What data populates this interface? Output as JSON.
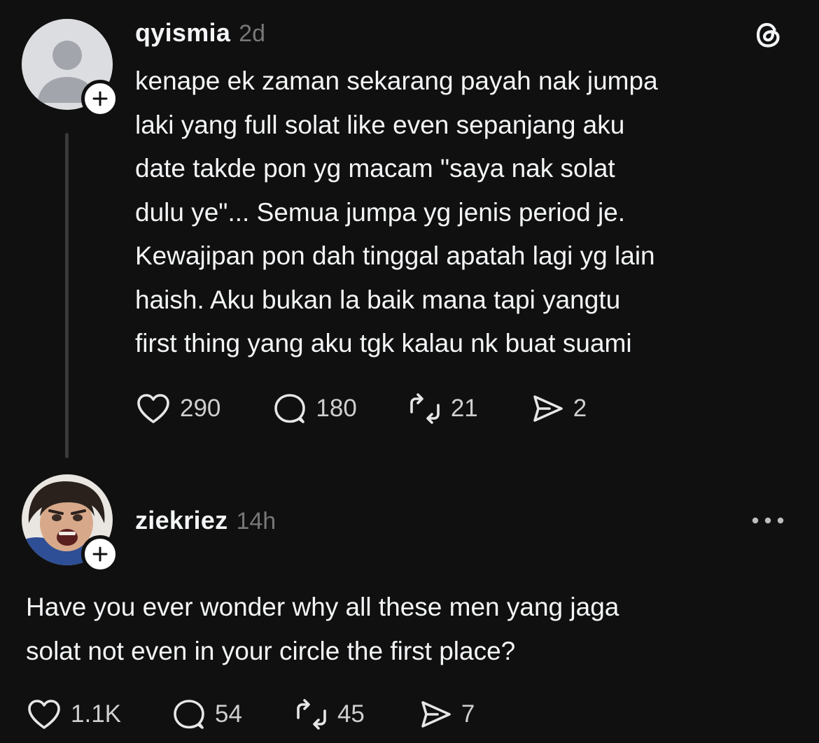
{
  "posts": [
    {
      "username": "qyismia",
      "time": "2d",
      "avatar": "default-avatar-icon",
      "text": "kenape ek zaman sekarang payah nak jumpa\nlaki yang full solat like even sepanjang aku\ndate takde pon yg macam \"saya nak solat\ndulu ye\"... Semua jumpa yg jenis period je.\nKewajipan pon dah tinggal apatah lagi yg lain\nhaish. Aku bukan la baik mana tapi yangtu\nfirst thing yang aku tgk kalau nk buat suami",
      "stats": {
        "likes": "290",
        "replies": "180",
        "reposts": "21",
        "shares": "2"
      }
    },
    {
      "username": "ziekriez",
      "time": "14h",
      "avatar": "user-photo-avatar",
      "text": "Have you ever wonder why all these men yang jaga\nsolat not even in your circle the first place?",
      "stats": {
        "likes": "1.1K",
        "replies": "54",
        "reposts": "45",
        "shares": "7"
      }
    }
  ],
  "icons": {
    "top_right": "threads-logo-icon",
    "more": "more-options-icon",
    "like": "heart-icon",
    "reply": "speech-bubble-icon",
    "repost": "repost-icon",
    "share": "send-icon",
    "follow": "plus-icon"
  },
  "colors": {
    "background": "#101010",
    "text": "#f3f5f7",
    "muted": "#777777",
    "thread_line": "#3a3a3a"
  }
}
